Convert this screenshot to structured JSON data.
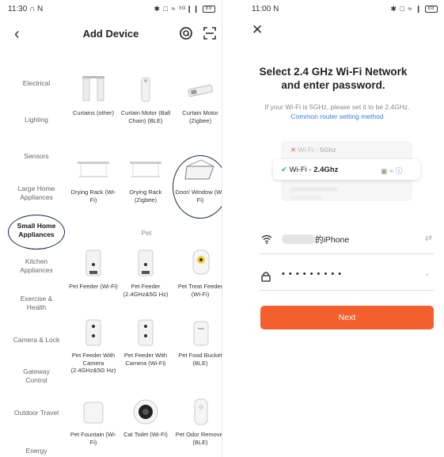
{
  "left_phone": {
    "status": {
      "time": "11:30",
      "extra": "∩ N",
      "icons": "✱ □ ≈ ³ᴳ❙❙",
      "battery": "89"
    },
    "header": {
      "title": "Add Device"
    },
    "categories": [
      {
        "label": "Electrical"
      },
      {
        "label": "Lighting"
      },
      {
        "label": "Sensors"
      },
      {
        "label": "Large Home Appliances"
      },
      {
        "label": "Small Home Appliances",
        "active": true
      },
      {
        "label": "Kitchen Appliances"
      },
      {
        "label": "Exercise & Health"
      },
      {
        "label": "Camera & Lock"
      },
      {
        "label": "Gateway Control"
      },
      {
        "label": "Outdoor Travel"
      },
      {
        "label": "Energy"
      }
    ],
    "section_pet": "Pet",
    "devices": [
      {
        "label": "Curtains (other)",
        "icon": "curtain-icon"
      },
      {
        "label": "Curtain Motor (Ball Chain) (BLE)",
        "icon": "curtain-motor-icon"
      },
      {
        "label": "Curtain Motor (Zigbee)",
        "icon": "curtain-motor-zigbee-icon"
      },
      {
        "label": "Drying Rack (Wi-Fi)",
        "icon": "drying-rack-icon"
      },
      {
        "label": "Drying Rack (Zigbee)",
        "icon": "drying-rack-icon"
      },
      {
        "label": "Door/ Window (Wi-Fi)",
        "icon": "door-window-icon"
      },
      {
        "label": "Pet Feeder (Wi-Fi)",
        "icon": "pet-feeder-icon"
      },
      {
        "label": "Pet Feeder (2.4GHz&5G Hz)",
        "icon": "pet-feeder-icon"
      },
      {
        "label": "Pet Treat Feeder (Wi-Fi)",
        "icon": "pet-treat-feeder-icon"
      },
      {
        "label": "Pet Feeder With Camera (2.4GHz&5G Hz)",
        "icon": "pet-feeder-camera-icon"
      },
      {
        "label": "Pet Feeder With Camera (Wi-Fi)",
        "icon": "pet-feeder-camera-icon"
      },
      {
        "label": "Pet Food Bucket (BLE)",
        "icon": "pet-food-bucket-icon"
      },
      {
        "label": "Pet Fountain (Wi-Fi)",
        "icon": "pet-fountain-icon"
      },
      {
        "label": "Cat Toilet (Wi-Fi)",
        "icon": "cat-toilet-icon"
      },
      {
        "label": "Pet Odor Remover (BLE)",
        "icon": "pet-odor-remover-icon"
      }
    ]
  },
  "right_phone": {
    "status": {
      "time": "11:00",
      "extra": "N",
      "icons": "✱ □ ≈ ❙",
      "battery": "88"
    },
    "title_line1": "Select 2.4 GHz Wi-Fi Network",
    "title_line2": "and enter password.",
    "subtitle": "If your Wi-Fi is 5GHz, please set it to be 2.4GHz.",
    "link": "Common router setting method",
    "card_bad_label": "Wi-Fi -",
    "card_bad_band": "5Ghz",
    "card_good_label": "Wi-Fi -",
    "card_good_band": "2.4Ghz",
    "ssid_suffix": "的iPhone",
    "password_mask": "• • • • • • • • •",
    "next_label": "Next",
    "accent": "#f4602d"
  }
}
